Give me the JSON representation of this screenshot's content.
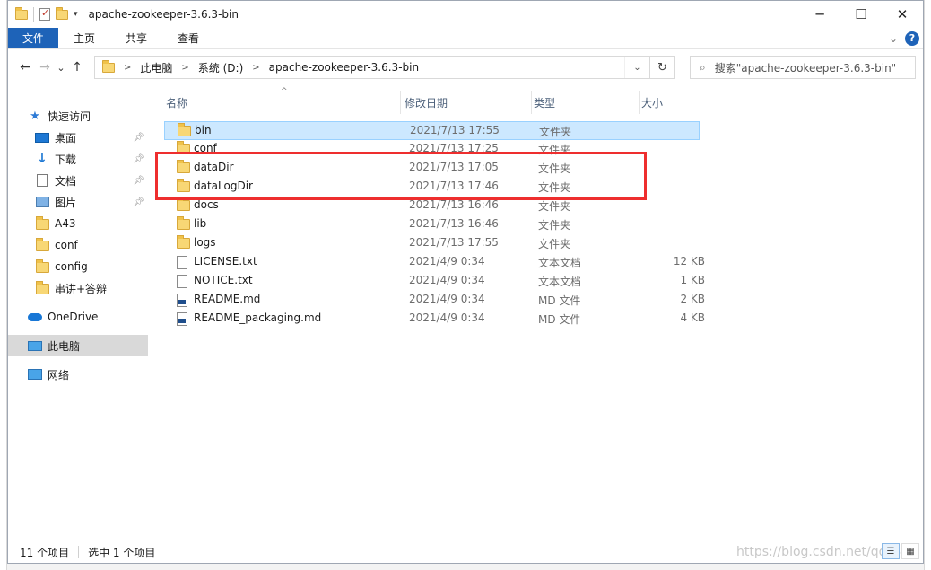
{
  "window": {
    "title": "apache-zookeeper-3.6.3-bin",
    "controls": {
      "minimize": "─",
      "maximize": "☐",
      "close": "✕"
    }
  },
  "ribbon": {
    "tabs": [
      "文件",
      "主页",
      "共享",
      "查看"
    ],
    "expand_icon": "chevron-down-icon",
    "help": "?"
  },
  "address": {
    "back": "←",
    "forward": "→",
    "recent": "⌄",
    "up": "↑",
    "breadcrumbs": [
      "此电脑",
      "系统 (D:)",
      "apache-zookeeper-3.6.3-bin"
    ],
    "refresh": "↻",
    "search_placeholder": "搜索\"apache-zookeeper-3.6.3-bin\""
  },
  "nav": {
    "items": [
      {
        "label": "快速访问",
        "icon": "star-icon",
        "pinned": false
      },
      {
        "label": "桌面",
        "icon": "desktop-icon",
        "pinned": true
      },
      {
        "label": "下载",
        "icon": "download-icon",
        "pinned": true
      },
      {
        "label": "文档",
        "icon": "document-icon",
        "pinned": true
      },
      {
        "label": "图片",
        "icon": "picture-icon",
        "pinned": true
      },
      {
        "label": "A43",
        "icon": "folder-icon",
        "pinned": false
      },
      {
        "label": "conf",
        "icon": "folder-icon",
        "pinned": false
      },
      {
        "label": "config",
        "icon": "folder-icon",
        "pinned": false
      },
      {
        "label": "串讲+答辩",
        "icon": "folder-icon",
        "pinned": false
      },
      {
        "label": "OneDrive",
        "icon": "cloud-icon",
        "pinned": false
      },
      {
        "label": "此电脑",
        "icon": "computer-icon",
        "pinned": false,
        "selected": true
      },
      {
        "label": "网络",
        "icon": "network-icon",
        "pinned": false
      }
    ]
  },
  "columns": {
    "name": "名称",
    "date": "修改日期",
    "type": "类型",
    "size": "大小"
  },
  "files": [
    {
      "name": "bin",
      "date": "2021/7/13 17:55",
      "type": "文件夹",
      "size": "",
      "icon": "folder-icon",
      "selected": true
    },
    {
      "name": "conf",
      "date": "2021/7/13 17:25",
      "type": "文件夹",
      "size": "",
      "icon": "folder-icon"
    },
    {
      "name": "dataDir",
      "date": "2021/7/13 17:05",
      "type": "文件夹",
      "size": "",
      "icon": "folder-icon"
    },
    {
      "name": "dataLogDir",
      "date": "2021/7/13 17:46",
      "type": "文件夹",
      "size": "",
      "icon": "folder-icon"
    },
    {
      "name": "docs",
      "date": "2021/7/13 16:46",
      "type": "文件夹",
      "size": "",
      "icon": "folder-icon"
    },
    {
      "name": "lib",
      "date": "2021/7/13 16:46",
      "type": "文件夹",
      "size": "",
      "icon": "folder-icon"
    },
    {
      "name": "logs",
      "date": "2021/7/13 17:55",
      "type": "文件夹",
      "size": "",
      "icon": "folder-icon"
    },
    {
      "name": "LICENSE.txt",
      "date": "2021/4/9 0:34",
      "type": "文本文档",
      "size": "12 KB",
      "icon": "text-file-icon"
    },
    {
      "name": "NOTICE.txt",
      "date": "2021/4/9 0:34",
      "type": "文本文档",
      "size": "1 KB",
      "icon": "text-file-icon"
    },
    {
      "name": "README.md",
      "date": "2021/4/9 0:34",
      "type": "MD 文件",
      "size": "2 KB",
      "icon": "md-file-icon"
    },
    {
      "name": "README_packaging.md",
      "date": "2021/4/9 0:34",
      "type": "MD 文件",
      "size": "4 KB",
      "icon": "md-file-icon"
    }
  ],
  "status": {
    "count": "11 个项目",
    "selection": "选中 1 个项目"
  },
  "watermark": "https://blog.csdn.net/qq_37",
  "colors": {
    "accent": "#1e63b8",
    "selection": "#cce8ff",
    "highlight": "#ee2e2e"
  }
}
